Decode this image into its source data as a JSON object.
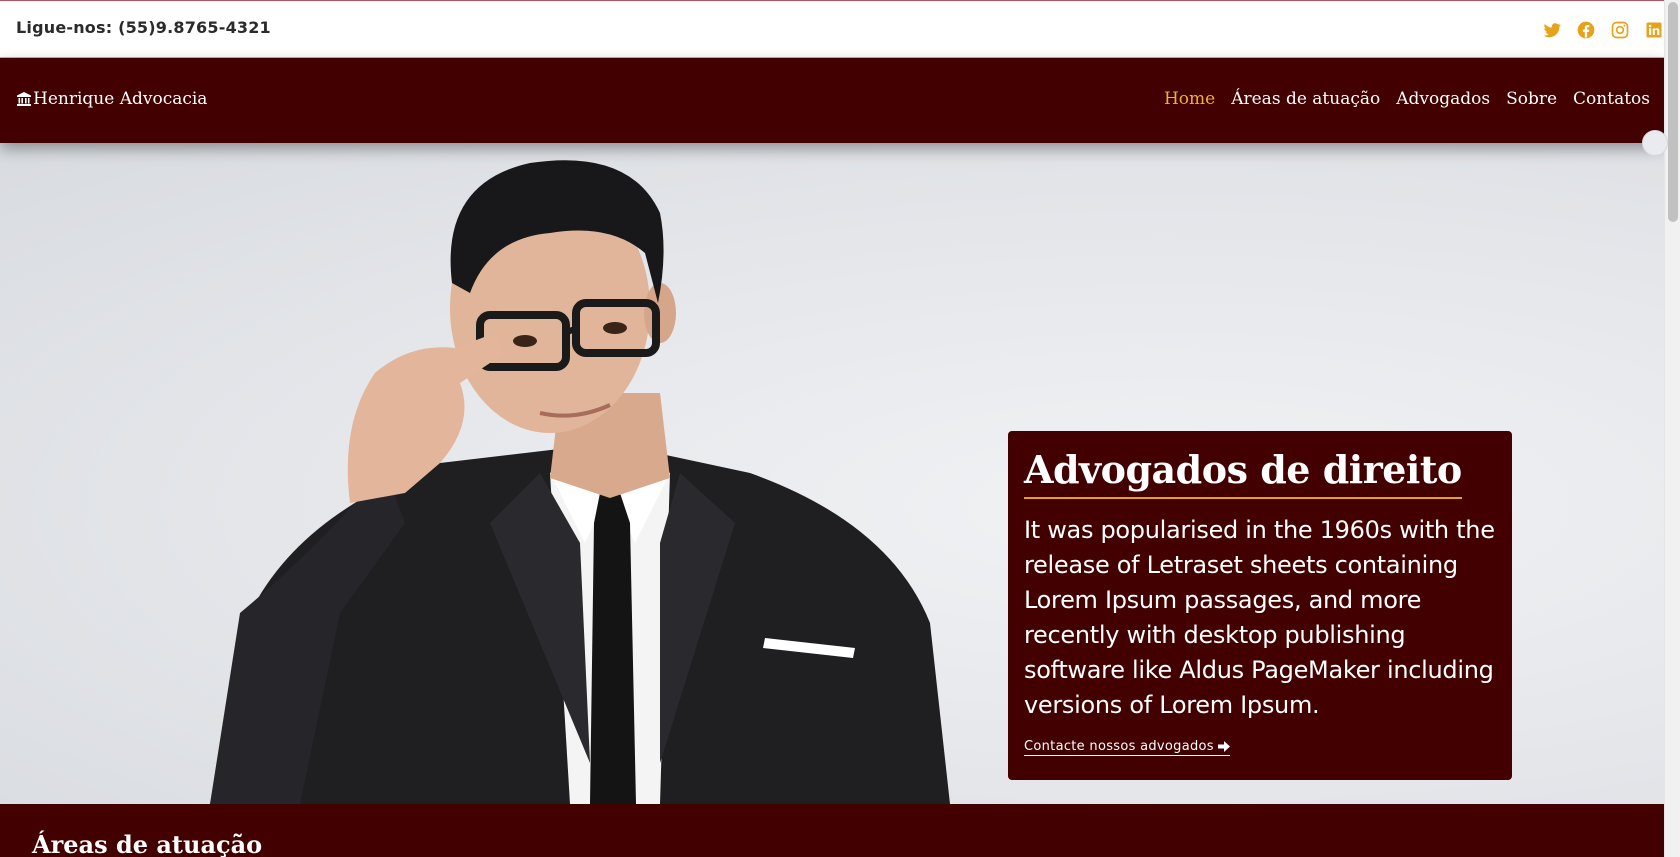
{
  "topbar": {
    "phone": "Ligue-nos: (55)9.8765-4321",
    "social_color": "#e8a21a",
    "socials": [
      "twitter-icon",
      "facebook-icon",
      "instagram-icon",
      "linkedin-icon"
    ]
  },
  "navbar": {
    "brand_icon": "courthouse-icon",
    "brand": "Henrique Advocacia",
    "items": [
      {
        "label": "Home",
        "active": true
      },
      {
        "label": "Áreas de atuação"
      },
      {
        "label": "Advogados"
      },
      {
        "label": "Sobre"
      },
      {
        "label": "Contatos"
      }
    ],
    "background": "#420000",
    "active_color": "#f0b030"
  },
  "hero": {
    "title": "Advogados de direito",
    "text": "It was popularised in the 1960s with the release of Letraset sheets containing Lorem Ipsum passages, and more recently with desktop publishing software like Aldus PageMaker including versions of Lorem Ipsum.",
    "cta": "Contacte nossos advogados",
    "cta_icon": "arrow-right-icon",
    "accent": "#e8a21a"
  },
  "section2": {
    "title": "Áreas de atuação"
  }
}
